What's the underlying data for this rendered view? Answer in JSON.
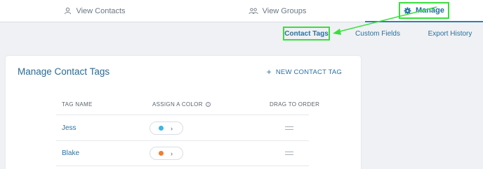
{
  "topnav": {
    "tabs": [
      {
        "label": "View Contacts",
        "icon": "user-icon"
      },
      {
        "label": "View Groups",
        "icon": "group-icon"
      },
      {
        "label": "Manage",
        "icon": "gear-icon"
      }
    ]
  },
  "subnav": {
    "tabs": [
      {
        "label": "Contact Tags"
      },
      {
        "label": "Custom Fields"
      },
      {
        "label": "Export History"
      }
    ]
  },
  "card": {
    "title": "Manage Contact Tags",
    "new_tag_label": "NEW CONTACT TAG",
    "columns": [
      "TAG NAME",
      "ASSIGN A COLOR",
      "DRAG TO ORDER"
    ],
    "rows": [
      {
        "name": "Jess",
        "color": "#40b4e5"
      },
      {
        "name": "Blake",
        "color": "#f07f33"
      }
    ]
  },
  "colors": {
    "accent": "#2d7fb3",
    "highlight": "#37e03a"
  }
}
